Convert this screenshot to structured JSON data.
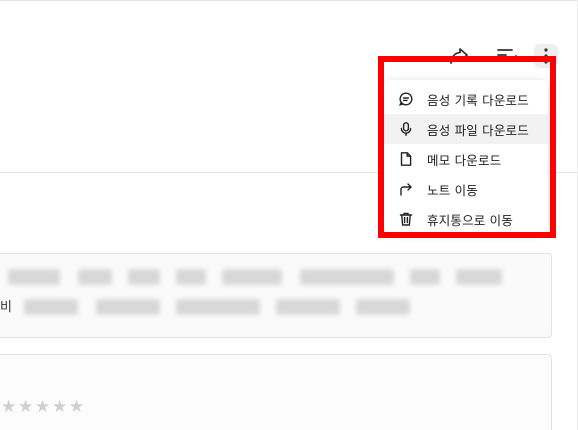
{
  "menu": {
    "items": [
      {
        "label": "음성 기록 다운로드",
        "icon": "transcript-icon"
      },
      {
        "label": "음성 파일 다운로드",
        "icon": "microphone-icon"
      },
      {
        "label": "메모 다운로드",
        "icon": "file-icon"
      },
      {
        "label": "노트 이동",
        "icon": "forward-arrow-icon"
      },
      {
        "label": "휴지통으로 이동",
        "icon": "trash-icon"
      }
    ]
  },
  "toolbar": {
    "icons": [
      "share-icon",
      "summary-icon",
      "more-vertical-icon"
    ]
  },
  "content": {
    "edge_char": "비",
    "rating": {
      "stars": "★★★★★",
      "filled": 0,
      "total": 5
    }
  },
  "colors": {
    "highlight": "#ff0000",
    "hover_bg": "#f2f2f2"
  }
}
